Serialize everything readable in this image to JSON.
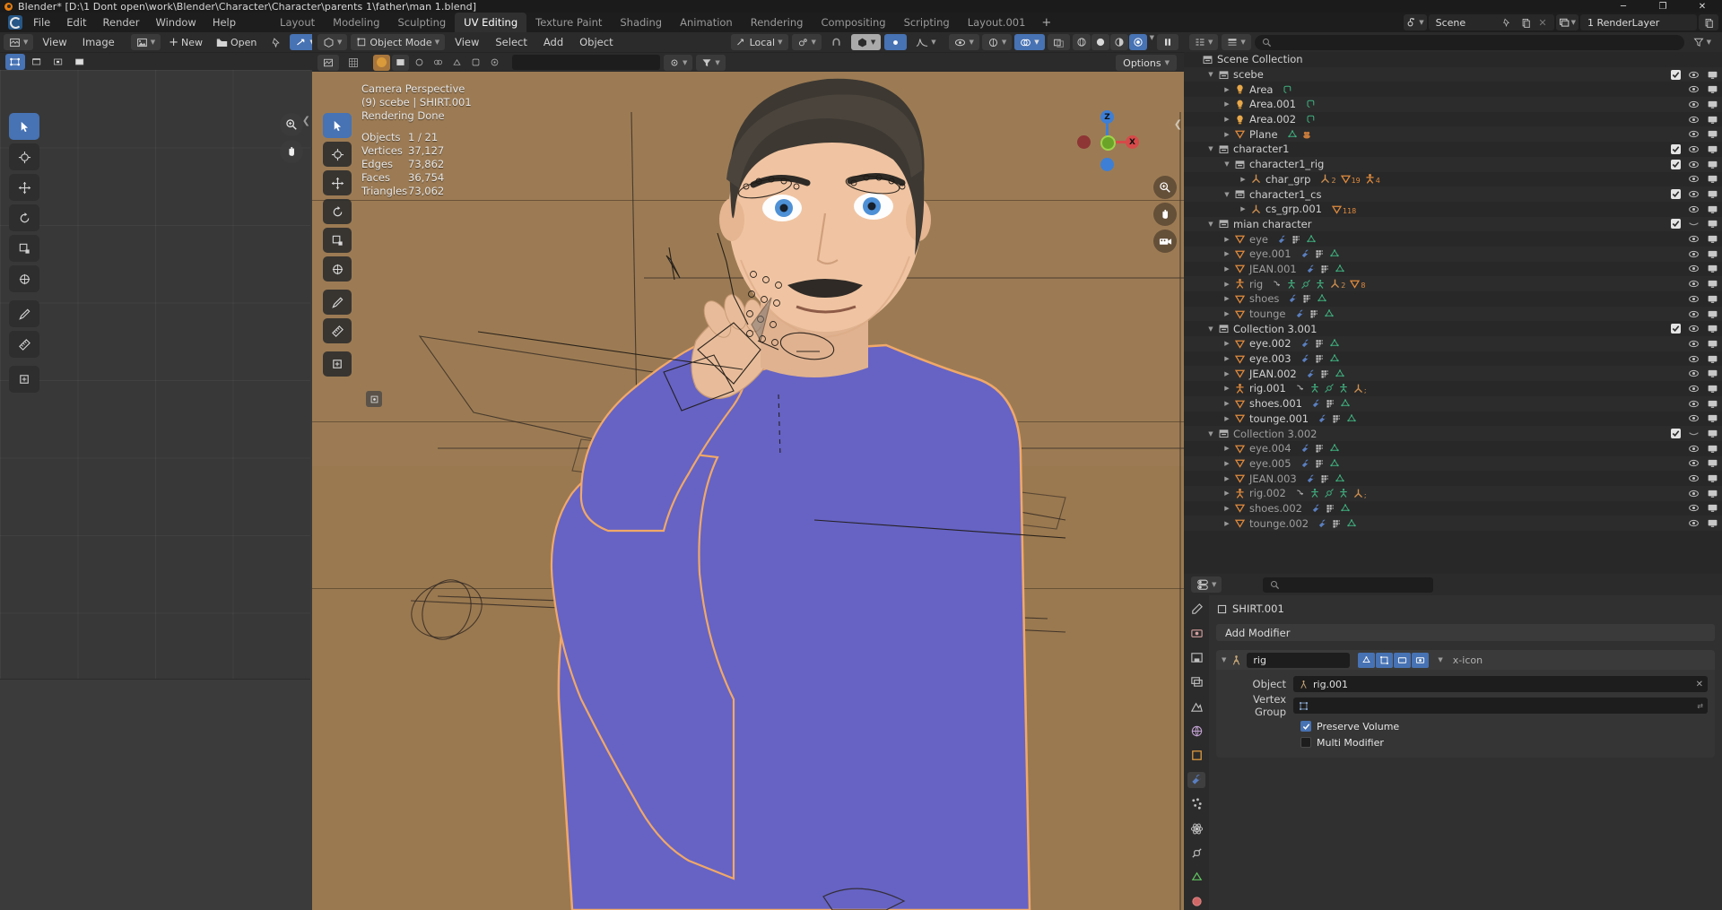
{
  "window": {
    "title": "Blender* [D:\\1 Dont open\\work\\Blender\\Character\\Character\\parents 1\\father\\man 1.blend]",
    "minimize": "─",
    "maximize": "❐",
    "close": "✕"
  },
  "topbar": {
    "menus": [
      "File",
      "Edit",
      "Render",
      "Window",
      "Help"
    ],
    "workspaces": [
      "Layout",
      "Modeling",
      "Sculpting",
      "UV Editing",
      "Texture Paint",
      "Shading",
      "Animation",
      "Rendering",
      "Compositing",
      "Scripting",
      "Layout.001"
    ],
    "active_workspace": "UV Editing",
    "add_workspace": "+",
    "scene_name": "Scene",
    "view_layer_name": "1 RenderLayer",
    "icons": [
      "scene-icon",
      "pin-icon",
      "copy-icon",
      "x-icon",
      "viewlayer-icon",
      "new-viewlayer-icon"
    ]
  },
  "uv_editor": {
    "header": {
      "editor_type_icon": "uv-editor-icon",
      "menus": [
        "View",
        "Image"
      ],
      "browse_image_icon": "image-browse-icon",
      "new_label": "New",
      "open_label": "Open",
      "icons": [
        "pin-icon",
        "uv-sync-icon",
        "display-channels-icon"
      ]
    },
    "subheader": {
      "select_mode_icons": [
        "uv-vertex-icon",
        "uv-edge-icon",
        "uv-face-icon",
        "uv-island-icon"
      ]
    },
    "tools": [
      "tweak-tool",
      "cursor-tool",
      "move-tool",
      "rotate-tool",
      "scale-tool",
      "transform-tool",
      "annotate-tool",
      "measure-tool",
      "add-primitive-tool"
    ],
    "active_tool": "tweak-tool",
    "nav_icons": [
      "zoom-icon",
      "pan-icon"
    ]
  },
  "viewport": {
    "header": {
      "editor_type_icon": "3d-viewport-icon",
      "mode": "Object Mode",
      "menus": [
        "View",
        "Select",
        "Add",
        "Object"
      ],
      "orientation": "Local",
      "icons": [
        "snap-icon",
        "magnet-icon",
        "proportional-edit-icon",
        "falloff-icon"
      ],
      "right_icons": [
        "visibility-icon",
        "gizmo-icon",
        "overlays-icon",
        "xray-icon",
        "shading-wireframe",
        "shading-solid",
        "shading-material",
        "shading-rendered",
        "pause-icon"
      ]
    },
    "subheader": {
      "icons": [
        "uv-editor-icon",
        "image-icon",
        "view-icon",
        "overlay-icon",
        "pivot-icon",
        "snap-icon",
        "proportional-icon"
      ],
      "search_placeholder": "",
      "options_label": "Options"
    },
    "overlay_text": {
      "line1": "Camera Perspective",
      "line2": "(9) scebe | SHIRT.001",
      "line3": "Rendering Done"
    },
    "stats": [
      {
        "label": "Objects",
        "value": "1 / 21"
      },
      {
        "label": "Vertices",
        "value": "37,127"
      },
      {
        "label": "Edges",
        "value": "73,862"
      },
      {
        "label": "Faces",
        "value": "36,754"
      },
      {
        "label": "Triangles",
        "value": "73,062"
      }
    ],
    "tools": [
      "tweak-tool",
      "cursor-tool",
      "move-tool",
      "rotate-tool",
      "scale-tool",
      "transform-tool",
      "annotate-tool",
      "measure-tool",
      "add-cube-tool"
    ],
    "active_tool": "tweak-tool",
    "gizmo_axes": [
      "Z",
      "X"
    ],
    "nav_icons": [
      "zoom-icon",
      "pan-icon",
      "camera-icon"
    ],
    "colors": {
      "background": "#9b7a52",
      "shirt": "#6663c4",
      "skin": "#e8bc9a",
      "hair": "#3d3832",
      "outline": "#f0a868"
    }
  },
  "outliner": {
    "header": {
      "display_mode_icon": "outliner-icon",
      "filter_icon": "filter-icon",
      "search_placeholder": "",
      "search_icon": "search-icon",
      "new_collection_icon": "new-collection-icon"
    },
    "rows": [
      {
        "depth": 0,
        "disclosure": "",
        "icon": "collection-icon",
        "label": "Scene Collection",
        "sub_icons": [],
        "checkbox": false,
        "eye": false,
        "screen": false,
        "dim": false
      },
      {
        "depth": 1,
        "disclosure": "down",
        "icon": "collection-icon",
        "label": "scebe",
        "sub_icons": [],
        "checkbox": true,
        "eye": true,
        "screen": true,
        "dim": false
      },
      {
        "depth": 2,
        "disclosure": "right",
        "icon": "light-icon",
        "label": "Area",
        "sub_icons": [
          "light-data-icon"
        ],
        "checkbox": false,
        "eye": true,
        "screen": true,
        "dim": false
      },
      {
        "depth": 2,
        "disclosure": "right",
        "icon": "light-icon",
        "label": "Area.001",
        "sub_icons": [
          "light-data-icon"
        ],
        "checkbox": false,
        "eye": true,
        "screen": true,
        "dim": false
      },
      {
        "depth": 2,
        "disclosure": "right",
        "icon": "light-icon",
        "label": "Area.002",
        "sub_icons": [
          "light-data-icon"
        ],
        "checkbox": false,
        "eye": true,
        "screen": true,
        "dim": false
      },
      {
        "depth": 2,
        "disclosure": "right",
        "icon": "mesh-icon",
        "label": "Plane",
        "sub_icons": [
          "mesh-data-icon",
          "material-icon"
        ],
        "checkbox": false,
        "eye": true,
        "screen": true,
        "dim": false
      },
      {
        "depth": 1,
        "disclosure": "down",
        "icon": "collection-icon",
        "label": "character1",
        "sub_icons": [],
        "checkbox": true,
        "eye": true,
        "screen": true,
        "dim": false
      },
      {
        "depth": 2,
        "disclosure": "down",
        "icon": "collection-icon",
        "label": "character1_rig",
        "sub_icons": [],
        "checkbox": true,
        "eye": true,
        "screen": true,
        "dim": false
      },
      {
        "depth": 3,
        "disclosure": "right",
        "icon": "empty-icon",
        "label": "char_grp",
        "sub_icons": [
          "empty-icon-2",
          "mesh-data-icon-19",
          "armature-icon-4"
        ],
        "checkbox": false,
        "eye": true,
        "screen": true,
        "dim": false
      },
      {
        "depth": 2,
        "disclosure": "down",
        "icon": "collection-icon",
        "label": "character1_cs",
        "sub_icons": [],
        "checkbox": true,
        "eye": true,
        "screen": true,
        "dim": false
      },
      {
        "depth": 3,
        "disclosure": "right",
        "icon": "empty-icon",
        "label": "cs_grp.001",
        "sub_icons": [
          "mesh-count-118"
        ],
        "checkbox": false,
        "eye": true,
        "screen": true,
        "dim": false
      },
      {
        "depth": 1,
        "disclosure": "down",
        "icon": "collection-icon",
        "label": "mian character",
        "sub_icons": [],
        "checkbox": true,
        "eye": "closed",
        "screen": true,
        "dim": false
      },
      {
        "depth": 2,
        "disclosure": "right",
        "icon": "mesh-icon",
        "label": "eye",
        "sub_icons": [
          "modifier-icon",
          "particles-icon",
          "mesh-data-icon"
        ],
        "checkbox": false,
        "eye": true,
        "screen": true,
        "dim": true
      },
      {
        "depth": 2,
        "disclosure": "right",
        "icon": "mesh-icon",
        "label": "eye.001",
        "sub_icons": [
          "modifier-icon",
          "particles-icon",
          "mesh-data-icon"
        ],
        "checkbox": false,
        "eye": true,
        "screen": true,
        "dim": true
      },
      {
        "depth": 2,
        "disclosure": "right",
        "icon": "mesh-icon",
        "label": "JEAN.001",
        "sub_icons": [
          "modifier-icon",
          "particles-icon",
          "mesh-data-icon"
        ],
        "checkbox": false,
        "eye": true,
        "screen": true,
        "dim": true
      },
      {
        "depth": 2,
        "disclosure": "right",
        "icon": "armature-icon",
        "label": "rig",
        "sub_icons": [
          "anim-icon",
          "pose-icon",
          "constraint-icon",
          "pose-icon-2",
          "empty-icon-2",
          "mesh-icon-8"
        ],
        "checkbox": false,
        "eye": true,
        "screen": true,
        "dim": true
      },
      {
        "depth": 2,
        "disclosure": "right",
        "icon": "mesh-icon",
        "label": "shoes",
        "sub_icons": [
          "modifier-icon",
          "particles-icon",
          "mesh-data-icon"
        ],
        "checkbox": false,
        "eye": true,
        "screen": true,
        "dim": true
      },
      {
        "depth": 2,
        "disclosure": "right",
        "icon": "mesh-icon",
        "label": "tounge",
        "sub_icons": [
          "modifier-icon",
          "particles-icon",
          "mesh-data-icon"
        ],
        "checkbox": false,
        "eye": true,
        "screen": true,
        "dim": true
      },
      {
        "depth": 1,
        "disclosure": "down",
        "icon": "collection-icon",
        "label": "Collection 3.001",
        "sub_icons": [],
        "checkbox": true,
        "eye": true,
        "screen": true,
        "dim": false
      },
      {
        "depth": 2,
        "disclosure": "right",
        "icon": "mesh-icon",
        "label": "eye.002",
        "sub_icons": [
          "modifier-icon",
          "particles-icon",
          "mesh-data-icon"
        ],
        "checkbox": false,
        "eye": true,
        "screen": true,
        "dim": false
      },
      {
        "depth": 2,
        "disclosure": "right",
        "icon": "mesh-icon",
        "label": "eye.003",
        "sub_icons": [
          "modifier-icon",
          "particles-icon",
          "mesh-data-icon"
        ],
        "checkbox": false,
        "eye": true,
        "screen": true,
        "dim": false
      },
      {
        "depth": 2,
        "disclosure": "right",
        "icon": "mesh-icon",
        "label": "JEAN.002",
        "sub_icons": [
          "modifier-icon",
          "particles-icon",
          "mesh-data-icon"
        ],
        "checkbox": false,
        "eye": true,
        "screen": true,
        "dim": false
      },
      {
        "depth": 2,
        "disclosure": "right",
        "icon": "armature-icon",
        "label": "rig.001",
        "sub_icons": [
          "anim-icon",
          "pose-icon",
          "constraint-icon",
          "pose-icon-2",
          "empty-icon-n"
        ],
        "checkbox": false,
        "eye": true,
        "screen": true,
        "dim": false
      },
      {
        "depth": 2,
        "disclosure": "right",
        "icon": "mesh-icon",
        "label": "shoes.001",
        "sub_icons": [
          "modifier-icon",
          "particles-icon",
          "mesh-data-icon"
        ],
        "checkbox": false,
        "eye": true,
        "screen": true,
        "dim": false
      },
      {
        "depth": 2,
        "disclosure": "right",
        "icon": "mesh-icon",
        "label": "tounge.001",
        "sub_icons": [
          "modifier-icon",
          "particles-icon",
          "mesh-data-icon"
        ],
        "checkbox": false,
        "eye": true,
        "screen": true,
        "dim": false
      },
      {
        "depth": 1,
        "disclosure": "down",
        "icon": "collection-icon",
        "label": "Collection 3.002",
        "sub_icons": [],
        "checkbox": true,
        "eye": "closed",
        "screen": true,
        "dim": true
      },
      {
        "depth": 2,
        "disclosure": "right",
        "icon": "mesh-icon",
        "label": "eye.004",
        "sub_icons": [
          "modifier-icon",
          "particles-icon",
          "mesh-data-icon"
        ],
        "checkbox": false,
        "eye": true,
        "screen": true,
        "dim": true
      },
      {
        "depth": 2,
        "disclosure": "right",
        "icon": "mesh-icon",
        "label": "eye.005",
        "sub_icons": [
          "modifier-icon",
          "particles-icon",
          "mesh-data-icon"
        ],
        "checkbox": false,
        "eye": true,
        "screen": true,
        "dim": true
      },
      {
        "depth": 2,
        "disclosure": "right",
        "icon": "mesh-icon",
        "label": "JEAN.003",
        "sub_icons": [
          "modifier-icon",
          "particles-icon",
          "mesh-data-icon"
        ],
        "checkbox": false,
        "eye": true,
        "screen": true,
        "dim": true
      },
      {
        "depth": 2,
        "disclosure": "right",
        "icon": "armature-icon",
        "label": "rig.002",
        "sub_icons": [
          "anim-icon",
          "pose-icon",
          "constraint-icon",
          "pose-icon-2",
          "empty-icon-n"
        ],
        "checkbox": false,
        "eye": true,
        "screen": true,
        "dim": true
      },
      {
        "depth": 2,
        "disclosure": "right",
        "icon": "mesh-icon",
        "label": "shoes.002",
        "sub_icons": [
          "modifier-icon",
          "particles-icon",
          "mesh-data-icon"
        ],
        "checkbox": false,
        "eye": true,
        "screen": true,
        "dim": true
      },
      {
        "depth": 2,
        "disclosure": "right",
        "icon": "mesh-icon",
        "label": "tounge.002",
        "sub_icons": [
          "modifier-icon",
          "particles-icon",
          "mesh-data-icon"
        ],
        "checkbox": false,
        "eye": true,
        "screen": true,
        "dim": true
      }
    ]
  },
  "properties": {
    "header": {
      "editor_type_icon": "properties-icon",
      "search_placeholder": "",
      "search_icon": "search-icon"
    },
    "tabs": [
      "tool-tab",
      "render-tab",
      "output-tab",
      "viewlayer-tab",
      "scene-tab",
      "world-tab",
      "object-tab",
      "modifier-tab",
      "particles-tab",
      "physics-tab",
      "constraint-tab",
      "data-tab",
      "material-tab"
    ],
    "active_tab": "modifier-tab",
    "breadcrumb_icon": "object-icon",
    "breadcrumb": "SHIRT.001",
    "add_modifier_label": "Add Modifier",
    "modifier": {
      "name": "rig",
      "expand_icon": "chevron-down-icon",
      "type_icon": "armature-modifier-icon",
      "toggle_icons": [
        "on-cage-icon",
        "edit-mode-icon",
        "realtime-icon",
        "render-icon"
      ],
      "dropdown_icon": "chevron-down-icon",
      "close_icon": "x-icon",
      "fields": [
        {
          "label": "Object",
          "value": "rig.001",
          "icon": "armature-icon",
          "clear": "✕"
        },
        {
          "label": "Vertex Group",
          "value": "",
          "icon": "vertex-group-icon",
          "clear": ""
        }
      ],
      "checkboxes": [
        {
          "label": "Preserve Volume",
          "checked": true
        },
        {
          "label": "Multi Modifier",
          "checked": false
        }
      ]
    }
  }
}
